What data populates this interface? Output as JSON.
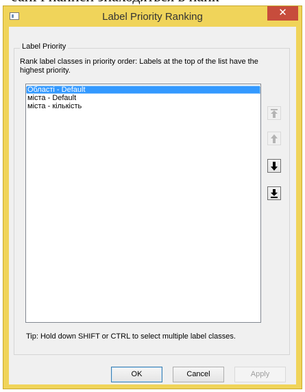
{
  "background_text": "еані і написи знаходяться в найк",
  "window": {
    "title": "Label Priority Ranking",
    "close_glyph": "✕"
  },
  "group": {
    "label": "Label Priority",
    "instructions": "Rank label classes in priority order: Labels at the top of the list have the highest priority."
  },
  "list": {
    "items": [
      "Області - Default",
      "міста - Default",
      "міста - кількість"
    ],
    "selected_index": 0
  },
  "move_buttons": {
    "move_to_top": {
      "icon": "arrow-top-icon",
      "enabled": false
    },
    "move_up": {
      "icon": "arrow-up-icon",
      "enabled": false
    },
    "move_down": {
      "icon": "arrow-down-icon",
      "enabled": true
    },
    "move_to_bottom": {
      "icon": "arrow-bottom-icon",
      "enabled": true
    }
  },
  "tip": "Tip: Hold down SHIFT or CTRL to select multiple label classes.",
  "buttons": {
    "ok": "OK",
    "cancel": "Cancel",
    "apply": "Apply",
    "apply_enabled": false
  },
  "colors": {
    "window_frame": "#f0d45a",
    "close_button": "#c74c3c",
    "selection": "#3399ff"
  }
}
